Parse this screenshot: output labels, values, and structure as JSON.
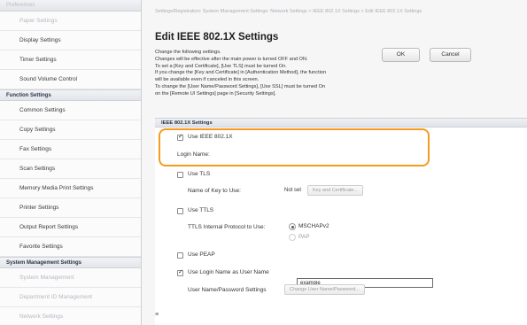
{
  "sidebar": {
    "top_section": "Preferences",
    "top_items": [
      {
        "label": "Paper Settings"
      },
      {
        "label": "Display Settings"
      },
      {
        "label": "Timer Settings"
      },
      {
        "label": "Sound Volume Control"
      }
    ],
    "function_section": "Function Settings",
    "function_items": [
      {
        "label": "Common Settings"
      },
      {
        "label": "Copy Settings"
      },
      {
        "label": "Fax Settings"
      },
      {
        "label": "Scan Settings"
      },
      {
        "label": "Memory Media Print Settings"
      },
      {
        "label": "Printer Settings"
      },
      {
        "label": "Output Report Settings"
      },
      {
        "label": "Favorite Settings"
      }
    ],
    "system_section": "System Management Settings",
    "system_items": [
      {
        "label": "System Management"
      },
      {
        "label": "Department ID Management"
      },
      {
        "label": "Network Settings"
      }
    ]
  },
  "breadcrumb": "Settings/Registration: System Management Settings: Network Settings > IEEE 802.1X Settings > Edit IEEE 802.1X Settings",
  "page_title": "Edit IEEE 802.1X Settings",
  "buttons": {
    "ok": "OK",
    "cancel": "Cancel"
  },
  "notes": [
    "Change the following settings.",
    "Changes will be effective after the main power is turned OFF and ON.",
    "To set a [Key and Certificate], [Use TLS] must be turned On.",
    "If you change the [Key and Certificate] in [Authentication Method], the function",
    "will be available even if canceled in this screen.",
    "To change the [User Name/Password Settings], [Use SSL] must be turned On",
    "on the [Remote UI Settings] page in [Security Settings]."
  ],
  "section_header": "IEEE 802.1X Settings",
  "use_ieee": {
    "label": "Use IEEE 802.1X",
    "checked": true
  },
  "login_name": {
    "label": "Login Name:",
    "value": "example"
  },
  "use_tls": {
    "label": "Use TLS",
    "checked": false
  },
  "key_name": {
    "label": "Name of Key to Use:",
    "value": "Not set",
    "button": "Key and Certificate..."
  },
  "use_ttls": {
    "label": "Use TTLS",
    "checked": false
  },
  "ttls_protocol": {
    "label": "TTLS Internal Protocol to Use:",
    "options": [
      "MSCHAPv2",
      "PAP"
    ],
    "selected": "MSCHAPv2"
  },
  "use_peap": {
    "label": "Use PEAP",
    "checked": false
  },
  "use_login_as_user": {
    "label": "Use Login Name as User Name",
    "checked": true
  },
  "user_pass": {
    "label": "User Name/Password Settings",
    "button": "Change User Name/Password..."
  },
  "bottom_icon": "≡",
  "colors": {
    "highlight": "#f39c1f"
  }
}
